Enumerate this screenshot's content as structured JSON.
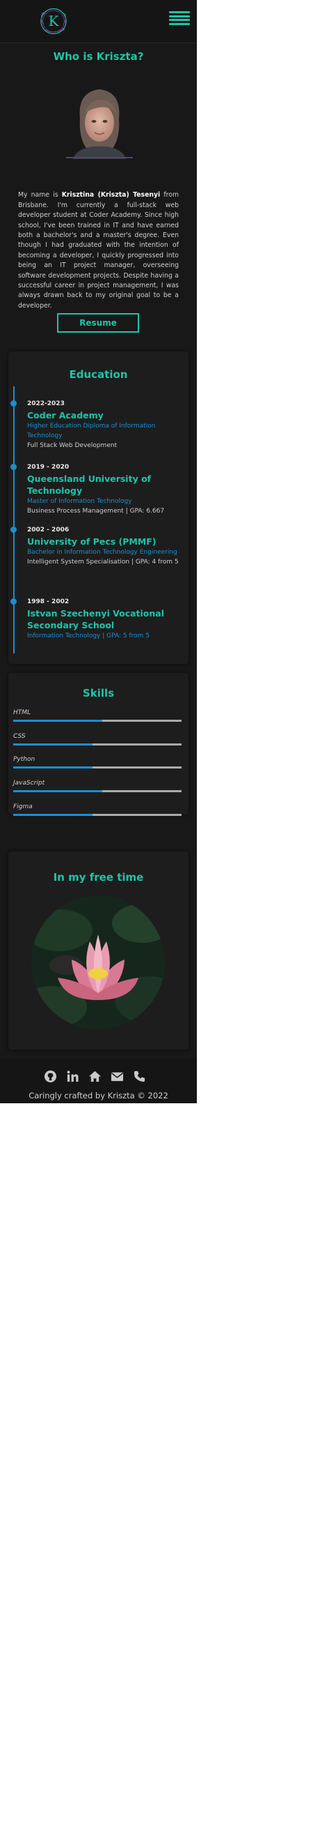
{
  "nav": {
    "logo_text": "K",
    "menu_icon": "hamburger-menu-icon"
  },
  "about": {
    "title": "Who is Kriszta?",
    "bio_intro": "My name is ",
    "bio_name": "Krisztina (Kriszta) Tesenyi",
    "bio_rest": " from Brisbane. I'm currently a full-stack web developer student at Coder Academy. Since high school, I've been trained in IT and have earned both a bachelor's and a master's degree. Even though I had graduated with the intention of becoming a developer, I quickly progressed into being an IT project manager, overseeing software development projects. Despite having a successful career in project management, I was always drawn back to my original goal to be a developer.",
    "resume_label": "Resume"
  },
  "education": {
    "title": "Education",
    "items": [
      {
        "years": "2022-2023",
        "school": "Coder Academy",
        "degree": "Higher Education Diploma of Information Technology",
        "detail": "Full Stack Web Development"
      },
      {
        "years": "2019 - 2020",
        "school": "Queensland University of Technology",
        "degree": "Master of Information Technology",
        "detail": "Business Process Management | GPA: 6.667"
      },
      {
        "years": "2002 - 2006",
        "school": "University of Pecs (PMMF)",
        "degree": "Bachelor in Information Technology Engineering",
        "detail": "Intelligent System Specialisation | GPA: 4 from 5"
      },
      {
        "years": "1998 - 2002",
        "school": "Istvan Szechenyi Vocational Secondary School",
        "degree": "Information Technology | GPA: 5 from 5",
        "detail": ""
      }
    ]
  },
  "skills": {
    "title": "Skills",
    "items": [
      {
        "name": "HTML",
        "level": 0.53
      },
      {
        "name": "CSS",
        "level": 0.47
      },
      {
        "name": "Python",
        "level": 0.47
      },
      {
        "name": "JavaScript",
        "level": 0.53
      },
      {
        "name": "Figma",
        "level": 0.47
      }
    ],
    "colors": {
      "fill": "#1b8fd0",
      "track": "#aaaaaa"
    }
  },
  "free_time": {
    "title": "In my free time"
  },
  "footer": {
    "icons": [
      "github-icon",
      "linkedin-icon",
      "home-icon",
      "envelope-icon",
      "phone-icon"
    ],
    "copyright": "Caringly crafted by Kriszta © 2022"
  },
  "colors": {
    "accent": "#1fc4a8",
    "blue": "#1b8fd0",
    "background": "#181818"
  }
}
